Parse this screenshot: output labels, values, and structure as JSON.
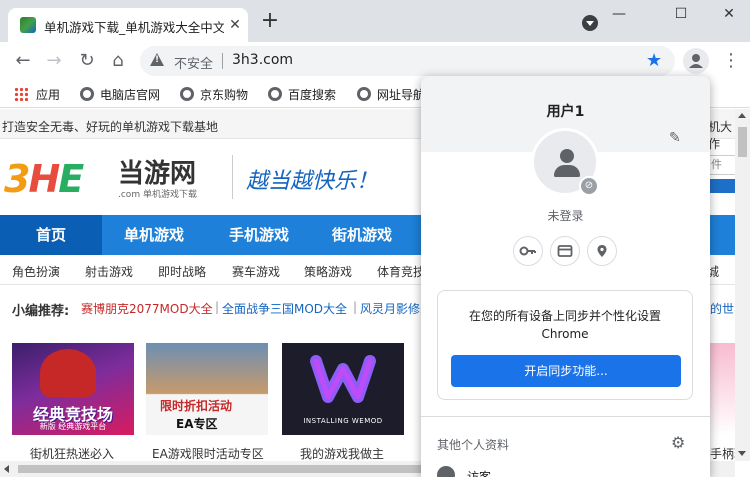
{
  "tab": {
    "title": "单机游戏下载_单机游戏大全中文",
    "close_glyph": "✕"
  },
  "window": {
    "new_tab_glyph": "+",
    "minimize_glyph": "—",
    "maximize_glyph": "☐",
    "close_glyph": "✕"
  },
  "toolbar": {
    "back_glyph": "←",
    "forward_glyph": "→",
    "reload_glyph": "↻",
    "home_glyph": "⌂",
    "insecure_label": "不安全",
    "url": "3h3.com",
    "star_glyph": "★",
    "menu_glyph": "⋮"
  },
  "bookmarks": [
    {
      "label": "应用",
      "icon": "apps-grid-icon"
    },
    {
      "label": "电脑店官网",
      "icon": "globe-icon"
    },
    {
      "label": "京东购物",
      "icon": "globe-icon"
    },
    {
      "label": "百度搜索",
      "icon": "globe-icon"
    },
    {
      "label": "网址导航",
      "icon": "globe-icon"
    }
  ],
  "site": {
    "slogan": "打造安全无毒、好玩的单机游戏下载基地",
    "top_right": "机大作",
    "logo_text": "当游网",
    "logo_sub": ".com 单机游戏下载",
    "motto": "越当越快乐！",
    "search_hint": "件",
    "nav": [
      "首页",
      "单机游戏",
      "手机游戏",
      "街机游戏"
    ],
    "subnav": [
      "角色扮演",
      "射击游戏",
      "即时战略",
      "赛车游戏",
      "策略游戏",
      "体育竞技",
      "城"
    ],
    "recommend_label": "小编推荐:",
    "recommend_links": [
      {
        "text": "赛博朋克2077MOD大全",
        "highlight": true
      },
      {
        "text": "全面战争三国MOD大全",
        "highlight": false
      },
      {
        "text": "风灵月影修改",
        "highlight": false
      },
      {
        "text": "的世界",
        "highlight": false
      }
    ],
    "cards": [
      {
        "caption": "街机狂热迷必入",
        "overlay": "经典竞技场",
        "overlay_sub": "新版 经典游戏平台"
      },
      {
        "caption": "EA游戏限时活动专区",
        "overlay": "限时折扣活动",
        "overlay_sub": "EA专区"
      },
      {
        "caption": "我的游戏我做主",
        "overlay": "INSTALLING WEMOD",
        "overlay_sub": ""
      },
      {
        "caption": "手柄玩",
        "overlay": "",
        "overlay_sub": ""
      }
    ]
  },
  "profile_popup": {
    "user_name": "用户1",
    "status": "未登录",
    "sync_line1": "在您的所有设备上同步并个性化设置",
    "sync_line2": "Chrome",
    "sync_button": "开启同步功能...",
    "other_profiles": "其他个人资料",
    "guest": "访客",
    "edit_glyph": "✎",
    "gear_glyph": "⚙"
  },
  "colors": {
    "accent": "#1a73e8",
    "nav_blue": "#1e80d8",
    "highlight_red": "#c62828"
  }
}
